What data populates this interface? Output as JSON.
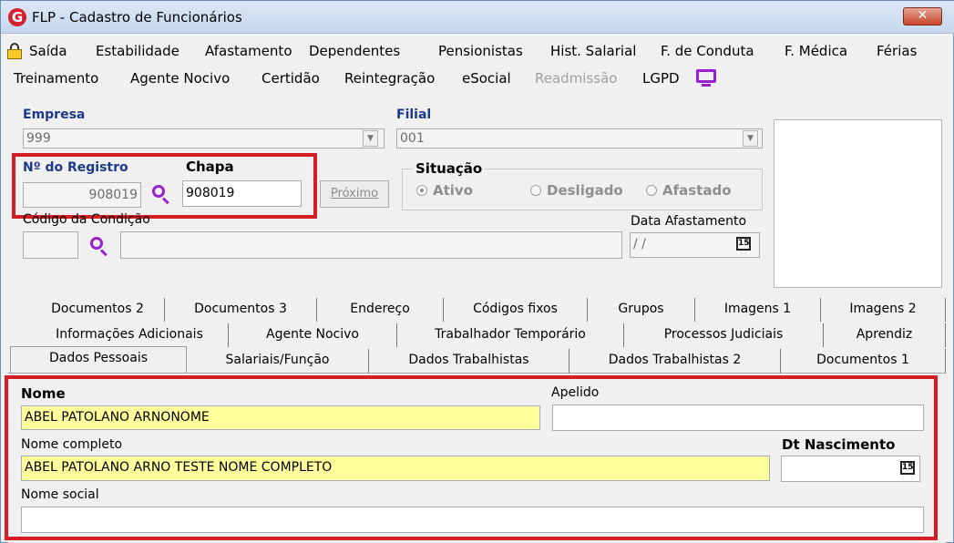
{
  "window": {
    "title": "FLP - Cadastro de Funcionários",
    "logo_letter": "G",
    "close_glyph": "✕"
  },
  "menu": {
    "row1": [
      {
        "label": "Saída",
        "icon": "lock-icon"
      },
      {
        "label": "Estabilidade"
      },
      {
        "label": "Afastamento"
      },
      {
        "label": "Dependentes"
      },
      {
        "label": "Pensionistas"
      },
      {
        "label": "Hist. Salarial"
      },
      {
        "label": "F. de Conduta"
      },
      {
        "label": "F. Médica"
      },
      {
        "label": "Férias"
      }
    ],
    "row2": [
      {
        "label": "Treinamento"
      },
      {
        "label": "Agente Nocivo"
      },
      {
        "label": "Certidão"
      },
      {
        "label": "Reintegração"
      },
      {
        "label": "eSocial"
      },
      {
        "label": "Readmissão",
        "disabled": true
      },
      {
        "label": "LGPD",
        "icon": "monitor-icon"
      }
    ]
  },
  "form": {
    "empresa_label": "Empresa",
    "empresa_value": "999",
    "filial_label": "Filial",
    "filial_value": "001",
    "registro_label": "Nº do Registro",
    "registro_value": "908019",
    "chapa_label": "Chapa",
    "chapa_value": "908019",
    "proximo_label": "Próximo",
    "situacao_label": "Situação",
    "situacao_options": [
      {
        "label": "Ativo",
        "checked": true
      },
      {
        "label": "Desligado",
        "checked": false
      },
      {
        "label": "Afastado",
        "checked": false
      }
    ],
    "codigo_condicao_label": "Código da Condição",
    "data_afastamento_label": "Data Afastamento",
    "data_afastamento_value": "/ /",
    "calendar_day": "15"
  },
  "tabs": {
    "row1": [
      "Documentos 2",
      "Documentos 3",
      "Endereço",
      "Códigos fixos",
      "Grupos",
      "Imagens 1",
      "Imagens 2"
    ],
    "row2": [
      "Informações Adicionais",
      "Agente Nocivo",
      "Trabalhador Temporário",
      "Processos Judiciais",
      "Aprendiz"
    ],
    "row3": [
      "Dados Pessoais",
      "Salariais/Função",
      "Dados Trabalhistas",
      "Dados Trabalhistas 2",
      "Documentos 1"
    ],
    "active": "Dados Pessoais"
  },
  "personal": {
    "nome_label": "Nome",
    "nome_value": "ABEL PATOLANO ARNONOME",
    "apelido_label": "Apelido",
    "apelido_value": "",
    "nome_completo_label": "Nome completo",
    "nome_completo_value": "ABEL PATOLANO ARNO TESTE NOME COMPLETO",
    "dt_nascimento_label": "Dt Nascimento",
    "dt_nascimento_value": "",
    "nome_social_label": "Nome social",
    "nome_social_value": ""
  },
  "colors": {
    "highlight_red": "#d51d24",
    "required_yellow": "#ffff9c",
    "label_blue": "#1d3a8a",
    "icon_purple": "#9a1fd1"
  }
}
